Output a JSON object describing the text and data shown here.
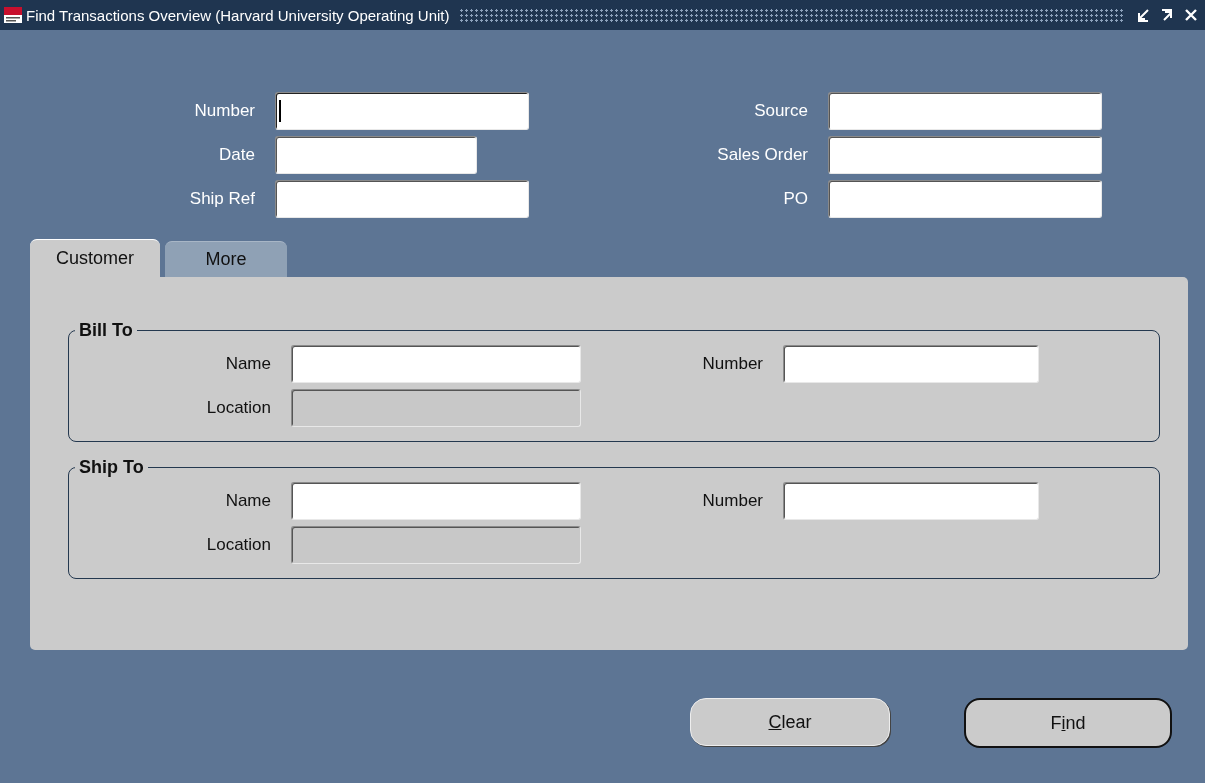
{
  "window": {
    "title": "Find Transactions Overview (Harvard University Operating Unit)"
  },
  "header_fields": {
    "left": [
      {
        "label": "Number",
        "focused": true
      },
      {
        "label": "Date",
        "focused": false
      },
      {
        "label": "Ship Ref",
        "focused": false
      }
    ],
    "right": [
      {
        "label": "Source",
        "focused": false
      },
      {
        "label": "Sales Order",
        "focused": false
      },
      {
        "label": "PO",
        "focused": false
      }
    ]
  },
  "tabs": [
    {
      "label": "Customer",
      "selected": true
    },
    {
      "label": "More",
      "selected": false
    }
  ],
  "groups": [
    {
      "title": "Bill To",
      "name_label": "Name",
      "number_label": "Number",
      "location_label": "Location",
      "location_disabled": true
    },
    {
      "title": "Ship To",
      "name_label": "Name",
      "number_label": "Number",
      "location_label": "Location",
      "location_disabled": true
    }
  ],
  "buttons": [
    {
      "key": "C",
      "after": "lear",
      "default": false
    },
    {
      "before": "F",
      "key": "i",
      "after": "nd",
      "default": true
    }
  ]
}
